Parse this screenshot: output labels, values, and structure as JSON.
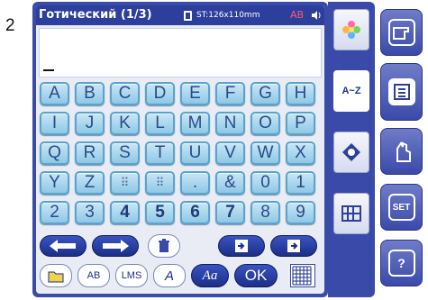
{
  "step_number": "2",
  "title_bar": {
    "title": "Готический (1/3)",
    "size": "ST:126x110mm",
    "case": "AB",
    "icons": [
      "pattern-icon",
      "speaker-icon"
    ]
  },
  "text_area": {
    "value": "",
    "cursor": "_"
  },
  "keyboard": {
    "rows": [
      [
        "A",
        "B",
        "C",
        "D",
        "E",
        "F",
        "G",
        "H"
      ],
      [
        "I",
        "J",
        "K",
        "L",
        "M",
        "N",
        "O",
        "P"
      ],
      [
        "Q",
        "R",
        "S",
        "T",
        "U",
        "V",
        "W",
        "X"
      ],
      [
        "Y",
        "Z",
        "⠿",
        "⠿",
        ".",
        "&",
        "0",
        "1"
      ],
      [
        "2",
        "3",
        "4",
        "5",
        "6",
        "7",
        "8",
        "9"
      ]
    ]
  },
  "controls": {
    "row1": [
      {
        "name": "back-arrow-button",
        "icon": "arrow-left-icon"
      },
      {
        "name": "forward-arrow-button",
        "icon": "arrow-right-icon"
      },
      {
        "name": "delete-button",
        "icon": "trash-icon"
      },
      {
        "name": "memory-in-button",
        "icon": "memory-in-icon"
      },
      {
        "name": "memory-out-button",
        "icon": "memory-out-icon"
      }
    ],
    "row2": [
      {
        "name": "folder-button",
        "icon": "folder-icon"
      },
      {
        "name": "case-toggle-button",
        "label": "AB"
      },
      {
        "name": "size-button",
        "label": "LMS"
      },
      {
        "name": "font-style-button",
        "label": "A"
      },
      {
        "name": "font-select-button",
        "label": "Aa"
      },
      {
        "name": "ok-button",
        "label": "OK"
      },
      {
        "name": "grid-button",
        "icon": "grid-icon"
      }
    ]
  },
  "side_tools": [
    {
      "name": "tool-flower",
      "icon": "flower-icon"
    },
    {
      "name": "tool-alphabet",
      "label": "A~Z"
    },
    {
      "name": "tool-monogram",
      "icon": "monogram-icon"
    },
    {
      "name": "tool-frame",
      "icon": "frame-icon"
    }
  ],
  "hard_buttons": [
    {
      "name": "hw-machine-button",
      "icon": "machine-icon"
    },
    {
      "name": "hw-embroidery-button",
      "icon": "embroidery-icon"
    },
    {
      "name": "hw-hand-button",
      "icon": "hand-icon"
    },
    {
      "name": "hw-set-button",
      "label": "SET"
    },
    {
      "name": "hw-help-button",
      "label": "?"
    }
  ],
  "colors": {
    "frame": "#3a4aa8",
    "title_bar": "#2c3f9c",
    "key_fill": "#a9d6ee",
    "key_border": "#5aa3cc",
    "case_text": "#ff5a6a"
  }
}
